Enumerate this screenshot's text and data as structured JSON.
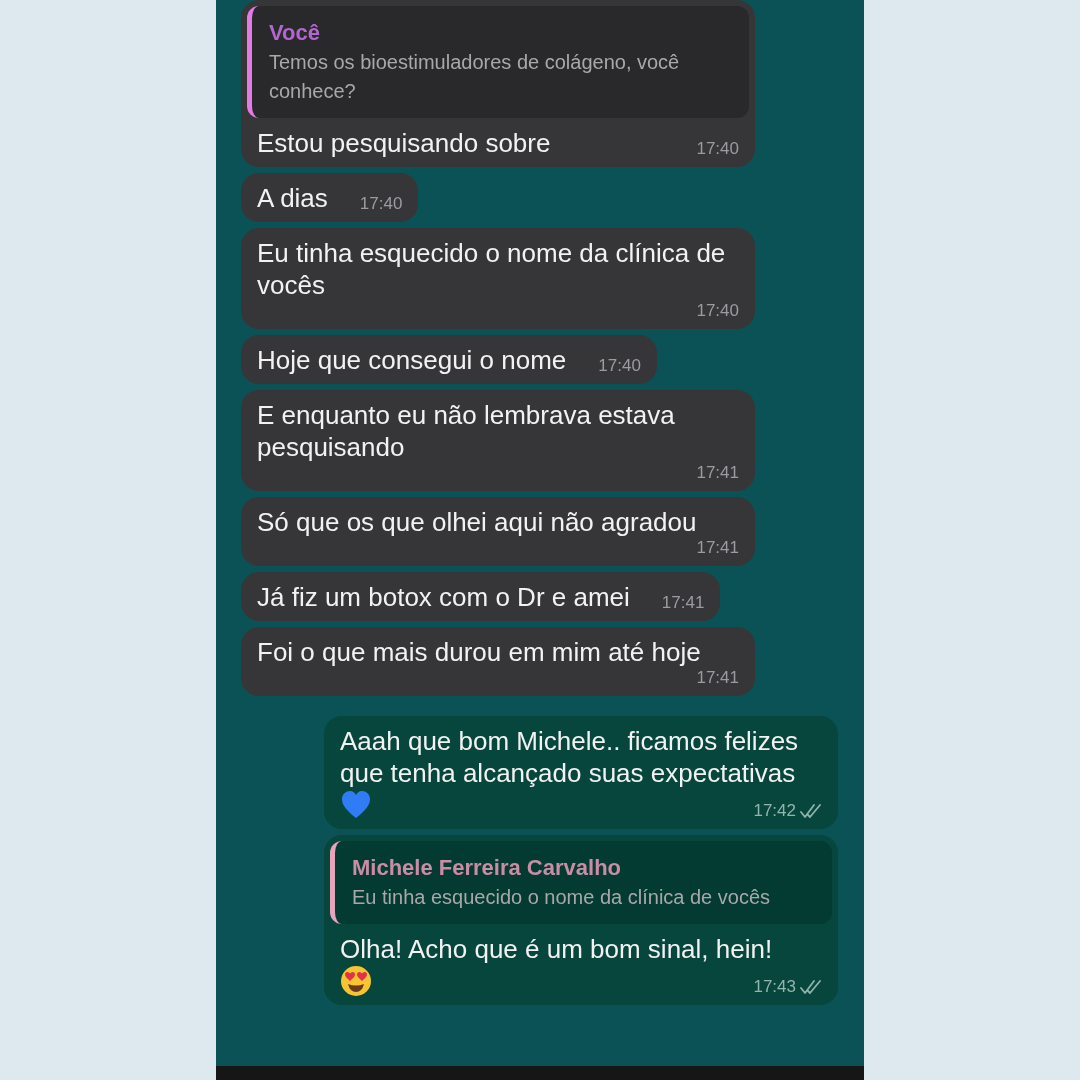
{
  "messages": [
    {
      "kind": "incoming",
      "reply": {
        "author": "Você",
        "text": "Temos os bioestimuladores de colágeno, você conhece?"
      },
      "text": "Estou pesquisando sobre",
      "time": "17:40"
    },
    {
      "kind": "incoming",
      "text": "A dias",
      "time": "17:40"
    },
    {
      "kind": "incoming",
      "text": "Eu tinha esquecido o nome da clínica de vocês",
      "time": "17:40"
    },
    {
      "kind": "incoming",
      "text": "Hoje que consegui o nome",
      "time": "17:40"
    },
    {
      "kind": "incoming",
      "text": "E enquanto eu não lembrava estava pesquisando",
      "time": "17:41"
    },
    {
      "kind": "incoming",
      "text": "Só que os que olhei aqui não agradou",
      "time": "17:41"
    },
    {
      "kind": "incoming",
      "text": "Já fiz um botox com o Dr e amei",
      "time": "17:41"
    },
    {
      "kind": "incoming",
      "text": "Foi o que mais durou em mim até hoje",
      "time": "17:41"
    },
    {
      "kind": "outgoing",
      "text": "Aaah que bom Michele.. ficamos felizes que tenha alcançado suas expectativas",
      "emoji": {
        "kind": "heart"
      },
      "time": "17:42",
      "delivered": true
    },
    {
      "kind": "outgoing",
      "reply": {
        "author": "Michele Ferreira Carvalho",
        "text": "Eu tinha esquecido o nome da clínica de vocês"
      },
      "text": "Olha! Acho que é um bom sinal, hein!",
      "emoji": {
        "kind": "smiley"
      },
      "time": "17:43",
      "delivered": true
    }
  ]
}
